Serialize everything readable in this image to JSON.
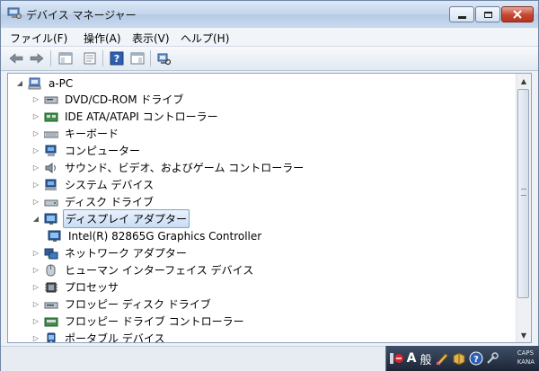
{
  "window": {
    "title": "デバイス マネージャー"
  },
  "menu": {
    "items": [
      "ファイル(F)",
      "操作(A)",
      "表示(V)",
      "ヘルプ(H)"
    ]
  },
  "toolbar": {
    "buttons": [
      "back-icon",
      "forward-icon",
      "properties-icon",
      "show-hide-console-tree-icon",
      "help-icon",
      "action-pane-icon",
      "scan-hardware-icon"
    ]
  },
  "tree": {
    "root": "a-PC",
    "items": [
      {
        "label": "DVD/CD-ROM ドライブ",
        "icon": "dvd-drive-icon",
        "expander": "collapsed"
      },
      {
        "label": "IDE ATA/ATAPI コントローラー",
        "icon": "ide-controller-icon",
        "expander": "collapsed"
      },
      {
        "label": "キーボード",
        "icon": "keyboard-icon",
        "expander": "collapsed"
      },
      {
        "label": "コンピューター",
        "icon": "computer-icon",
        "expander": "collapsed"
      },
      {
        "label": "サウンド、ビデオ、およびゲーム コントローラー",
        "icon": "sound-icon",
        "expander": "collapsed"
      },
      {
        "label": "システム デバイス",
        "icon": "system-device-icon",
        "expander": "collapsed"
      },
      {
        "label": "ディスク ドライブ",
        "icon": "disk-drive-icon",
        "expander": "collapsed"
      },
      {
        "label": "ディスプレイ アダプター",
        "icon": "display-adapter-icon",
        "expander": "expanded",
        "selected": true
      },
      {
        "label": "Intel(R) 82865G Graphics Controller",
        "icon": "display-adapter-icon",
        "child": true
      },
      {
        "label": "ネットワーク アダプター",
        "icon": "network-adapter-icon",
        "expander": "collapsed"
      },
      {
        "label": "ヒューマン インターフェイス デバイス",
        "icon": "hid-icon",
        "expander": "collapsed"
      },
      {
        "label": "プロセッサ",
        "icon": "processor-icon",
        "expander": "collapsed"
      },
      {
        "label": "フロッピー ディスク ドライブ",
        "icon": "floppy-drive-icon",
        "expander": "collapsed"
      },
      {
        "label": "フロッピー ドライブ コントローラー",
        "icon": "floppy-controller-icon",
        "expander": "collapsed"
      },
      {
        "label": "ポータブル デバイス",
        "icon": "portable-device-icon",
        "expander": "collapsed"
      }
    ]
  },
  "language_bar": {
    "input_mode": "A",
    "conversion": "般",
    "caps": "CAPS",
    "kana": "KANA"
  }
}
